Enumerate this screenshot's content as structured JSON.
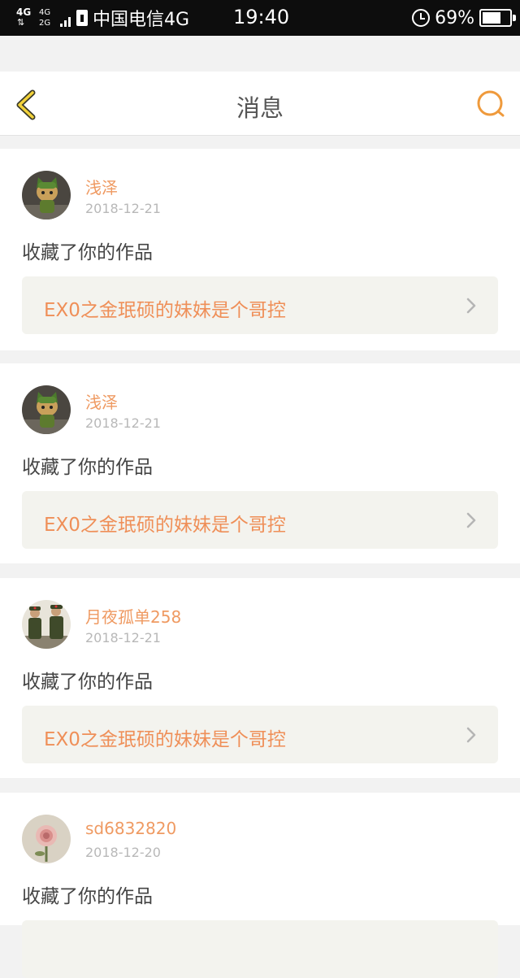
{
  "status_bar": {
    "network_top": "4G",
    "network_arrows": "⇅",
    "network2_a": "4G",
    "network2_b": "2G",
    "carrier": "中国电信4G",
    "time": "19:40",
    "battery_percent": "69%",
    "battery_level": 0.69
  },
  "header": {
    "title": "消息",
    "back_icon": "chevron-left-icon",
    "search_icon": "search-icon",
    "accent_color": "#ef9a3c"
  },
  "messages": [
    {
      "username": "浅泽",
      "date": "2018-12-21",
      "action": "收藏了你的作品",
      "work_title": "EX0之金珉硕的妹妹是个哥控"
    },
    {
      "username": "浅泽",
      "date": "2018-12-21",
      "action": "收藏了你的作品",
      "work_title": "EX0之金珉硕的妹妹是个哥控"
    },
    {
      "username": "月夜孤单258",
      "date": "2018-12-21",
      "action": "收藏了你的作品",
      "work_title": "EX0之金珉硕的妹妹是个哥控"
    },
    {
      "username": "sd6832820",
      "date": "2018-12-20",
      "action": "收藏了你的作品",
      "work_title": ""
    }
  ]
}
